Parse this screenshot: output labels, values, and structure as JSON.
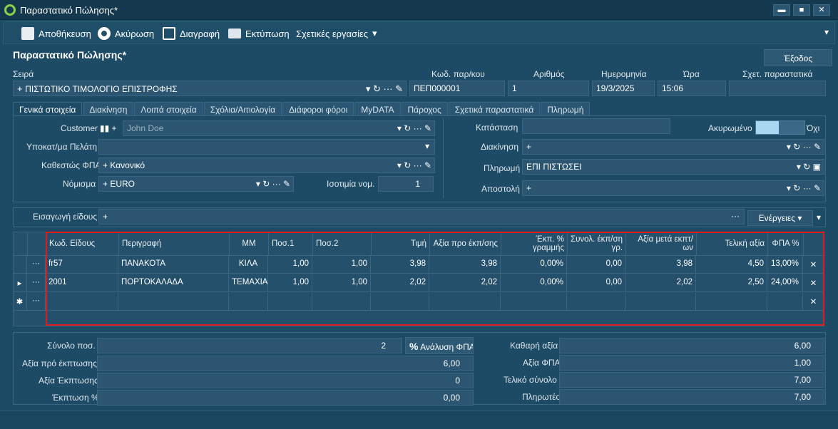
{
  "window": {
    "title": "Παραστατικό Πώλησης*",
    "min": "▬",
    "max": "■",
    "close": "✕"
  },
  "toolbar": {
    "save": "Αποθήκευση",
    "cancel": "Ακύρωση",
    "delete": "Διαγραφή",
    "print": "Εκτύπωση",
    "related": "Σχετικές εργασίες",
    "dropdown": "▾",
    "overflow": "▾"
  },
  "header": {
    "title": "Παραστατικό Πώλησης*",
    "exit": "Έξοδος"
  },
  "doc": {
    "series_label": "Σειρά",
    "series_value": "ΠΙΣΤΩΤΙΚΟ ΤΙΜΟΛΟΓΙΟ ΕΠΙΣΤΡΟΦΗΣ",
    "code_label": "Κωδ. παρ/κου",
    "code_value": "ΠΕΠ000001",
    "number_label": "Αριθμός",
    "number_value": "1",
    "date_label": "Ημερομηνία",
    "date_value": "19/3/2025",
    "time_label": "Ώρα",
    "time_value": "15:06",
    "related_label": "Σχετ. παραστατικά",
    "related_value": ""
  },
  "tabs": [
    "Γενικά στοιχεία",
    "Διακίνηση",
    "Λοιπά στοιχεία",
    "Σχόλια/Αιτιολογία",
    "Διάφοροι φόροι",
    "MyDATA",
    "Πάροχος",
    "Σχετικά παραστατικά",
    "Πληρωμή"
  ],
  "general": {
    "customer_label": "Customer",
    "customer_value": "John Doe",
    "branch_label": "Υποκατ/μα Πελάτη",
    "branch_value": "",
    "vat_status_label": "Καθεστώς ΦΠΑ",
    "vat_status_value": "Κανονικό",
    "currency_label": "Νόμισμα",
    "currency_value": "EURO",
    "rate_label": "Ισοτιμία νομ.",
    "rate_value": "1",
    "state_label": "Κατάσταση",
    "state_value": "",
    "cancelled_label": "Ακυρωμένο",
    "cancelled_value": "Όχι",
    "shipping_label": "Διακίνηση",
    "shipping_value": "",
    "payment_label": "Πληρωμή",
    "payment_value": "ΕΠΙ ΠΙΣΤΩΣΕΙ",
    "dispatch_label": "Αποστολή",
    "dispatch_value": ""
  },
  "entry": {
    "label": "Εισαγωγή είδους",
    "value": "",
    "actions": "Ενέργειες"
  },
  "grid": {
    "headers": [
      "Κωδ. Είδους",
      "Περιγραφή",
      "ΜΜ",
      "Ποσ.1",
      "Ποσ.2",
      "Τιμή",
      "Αξία προ έκπ/σης",
      "Έκπ. % γραμμής",
      "Συνολ. έκπ/ση γρ.",
      "Αξία μετά εκπτ/ων",
      "Τελική αξία",
      "ΦΠΑ %"
    ],
    "rows": [
      [
        "fr57",
        "ΠΑΝΑΚΟΤΑ",
        "ΚΙΛΑ",
        "1,00",
        "1,00",
        "3,98",
        "3,98",
        "0,00%",
        "0,00",
        "3,98",
        "4,50",
        "13,00%"
      ],
      [
        "2001",
        "ΠΟΡΤΟΚΑΛΑΔΑ",
        "ΤΕΜΑΧΙΑ",
        "1,00",
        "1,00",
        "2,02",
        "2,02",
        "0,00%",
        "0,00",
        "2,02",
        "2,50",
        "24,00%"
      ]
    ],
    "row_menu": "···",
    "delete": "✕",
    "new_row_marker": "✱",
    "current_marker": "▸"
  },
  "totals": {
    "qty_label": "Σύνολο ποσ.",
    "qty_value": "2",
    "vat_analysis": "Ανάλυση ΦΠΑ",
    "gross_label": "Αξία πρό έκπτωσης",
    "gross_value": "6,00",
    "disc_label": "Αξία Έκπτωσης",
    "disc_value": "0",
    "discpct_label": "Έκπτωση %",
    "discpct_value": "0,00",
    "net_label": "Καθαρή αξία",
    "net_value": "6,00",
    "vat_label": "Αξία ΦΠΑ",
    "vat_value": "1,00",
    "total_label": "Τελικό σύνολο",
    "total_value": "7,00",
    "payable_label": "Πληρωτέο",
    "payable_value": "7,00"
  }
}
